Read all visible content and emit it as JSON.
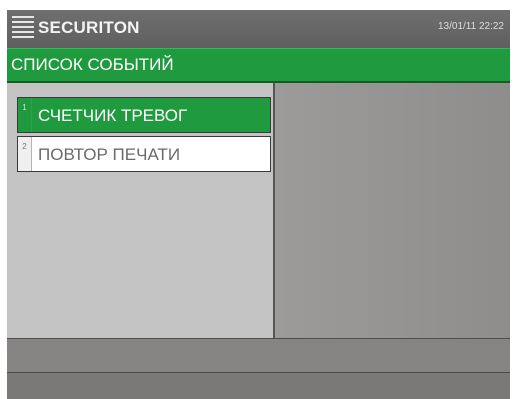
{
  "header": {
    "brand": "SECURITON",
    "datetime": "13/01/11 22:22",
    "menu_icon": "menu-icon"
  },
  "list": {
    "title": "СПИСОК СОБЫТИЙ",
    "items": [
      {
        "number": "1",
        "label": "СЧЕТЧИК ТРЕВОГ",
        "selected": true
      },
      {
        "number": "2",
        "label": "ПОВТОР ПЕЧАТИ",
        "selected": false
      }
    ]
  },
  "colors": {
    "accent_green": "#1f9a3e",
    "title_bar": "#666666",
    "left_panel": "#c3c3c3",
    "right_panel": "#939291"
  }
}
